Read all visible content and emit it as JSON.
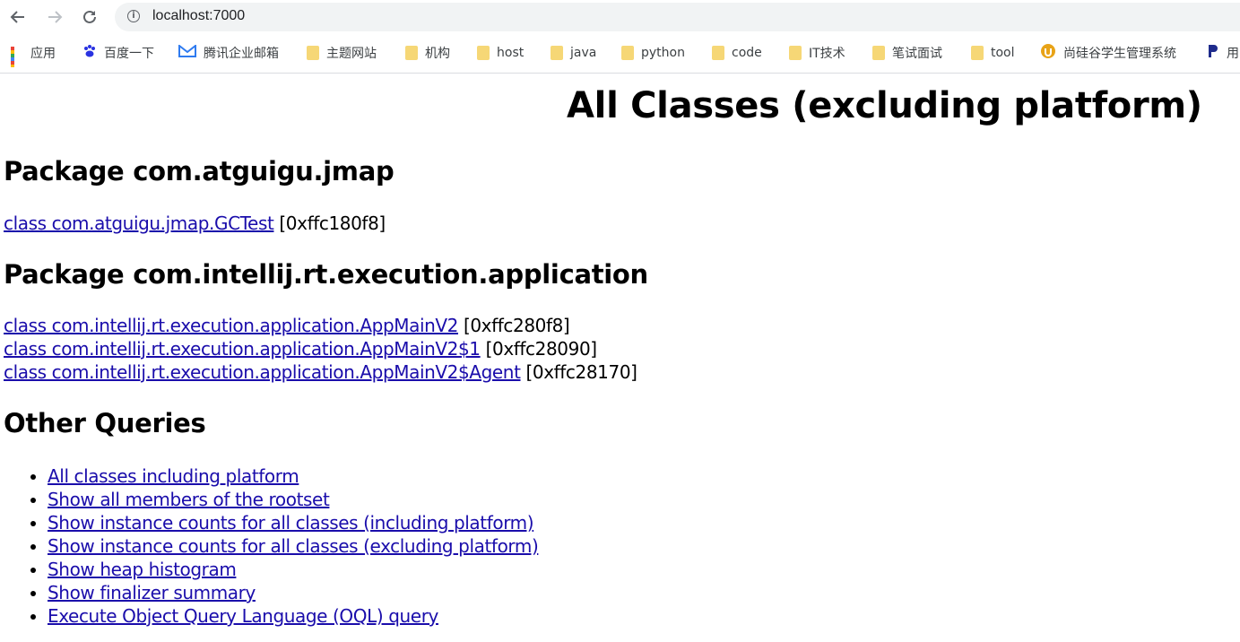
{
  "browser": {
    "url": "localhost:7000",
    "bookmarks": [
      {
        "label": "应用",
        "icon": "apps-grid-icon"
      },
      {
        "label": "百度一下",
        "icon": "baidu-paw-icon"
      },
      {
        "label": "腾讯企业邮箱",
        "icon": "tencent-mail-icon"
      },
      {
        "label": "主题网站",
        "icon": "folder-icon"
      },
      {
        "label": "机构",
        "icon": "folder-icon"
      },
      {
        "label": "host",
        "icon": "folder-icon"
      },
      {
        "label": "java",
        "icon": "folder-icon"
      },
      {
        "label": "python",
        "icon": "folder-icon"
      },
      {
        "label": "code",
        "icon": "folder-icon"
      },
      {
        "label": "IT技术",
        "icon": "folder-icon"
      },
      {
        "label": "笔试面试",
        "icon": "folder-icon"
      },
      {
        "label": "tool",
        "icon": "folder-icon"
      },
      {
        "label": "尚硅谷学生管理系统",
        "icon": "site-power-icon"
      },
      {
        "label": "用",
        "icon": "p-logo-icon"
      }
    ]
  },
  "page": {
    "title": "All Classes (excluding platform)",
    "packages": [
      {
        "heading": "Package com.atguigu.jmap",
        "classes": [
          {
            "name": "class com.atguigu.jmap.GCTest",
            "address": "[0xffc180f8]"
          }
        ]
      },
      {
        "heading": "Package com.intellij.rt.execution.application",
        "classes": [
          {
            "name": "class com.intellij.rt.execution.application.AppMainV2",
            "address": "[0xffc280f8]"
          },
          {
            "name": "class com.intellij.rt.execution.application.AppMainV2$1",
            "address": "[0xffc28090]"
          },
          {
            "name": "class com.intellij.rt.execution.application.AppMainV2$Agent",
            "address": "[0xffc28170]"
          }
        ]
      }
    ],
    "other_queries_heading": "Other Queries",
    "other_queries": [
      "All classes including platform",
      "Show all members of the rootset",
      "Show instance counts for all classes (including platform)",
      "Show instance counts for all classes (excluding platform)",
      "Show heap histogram",
      "Show finalizer summary",
      "Execute Object Query Language (OQL) query"
    ]
  },
  "colors": {
    "link": "#1a0dab",
    "folder": "#f6d776"
  }
}
